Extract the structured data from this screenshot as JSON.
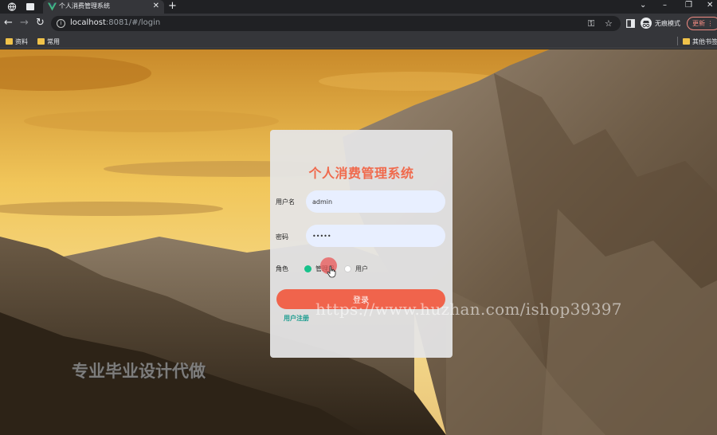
{
  "browser": {
    "tab": {
      "title": "个人消费管理系统"
    },
    "url": {
      "host": "localhost",
      "path": ":8081/#/login"
    },
    "profile_label": "无痕模式",
    "update_label": "更新",
    "bookmarks": [
      {
        "label": "资料"
      },
      {
        "label": "常用"
      }
    ],
    "other_bookmarks_label": "其他书签"
  },
  "login": {
    "title": "个人消费管理系统",
    "username_label": "用户名",
    "username_value": "admin",
    "password_label": "密码",
    "password_value": "•••••",
    "role_label": "角色",
    "roles": [
      {
        "label": "管理员",
        "checked": true
      },
      {
        "label": "用户",
        "checked": false
      }
    ],
    "submit_label": "登录",
    "register_label": "用户注册"
  },
  "watermarks": {
    "url": "https://www.huzhan.com/ishop39397",
    "ad": "专业毕业设计代做"
  },
  "colors": {
    "accent": "#f0644c",
    "title": "#f06a4d",
    "radio_checked": "#17c28b",
    "link": "#1a9c8f"
  }
}
